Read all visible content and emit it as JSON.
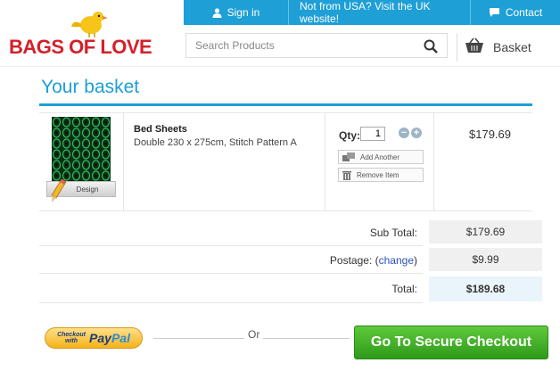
{
  "header": {
    "logo_text": "BAGS OF LOVE",
    "nav": {
      "sign_in": "Sign in",
      "uk_site": "Not from USA? Visit the UK website!",
      "contact": "Contact"
    },
    "search": {
      "placeholder": "Search Products"
    },
    "basket_label": "Basket"
  },
  "page": {
    "title": "Your basket"
  },
  "item": {
    "name": "Bed Sheets",
    "description": "Double 230 x 275cm, Stitch Pattern A",
    "design_label": "Design",
    "qty_label": "Qty:",
    "qty_value": "1",
    "add_another": "Add Another",
    "remove_item": "Remove Item",
    "price": "$179.69"
  },
  "totals": {
    "subtotal_label": "Sub Total:",
    "subtotal": "$179.69",
    "postage_label": "Postage: (",
    "postage_change": "change",
    "postage_close": ")",
    "postage": "$9.99",
    "total_label": "Total:",
    "total": "$189.68"
  },
  "checkout": {
    "paypal_small": "Checkout with",
    "paypal_word_1": "Pay",
    "paypal_word_2": "Pal",
    "or_text": "Or",
    "secure_checkout": "Go To Secure Checkout"
  },
  "colors": {
    "accent": "#1e9fd6",
    "logo_red": "#d4202a",
    "checkout_green": "#3aa824",
    "thumb_bg": "#0a2f18"
  }
}
